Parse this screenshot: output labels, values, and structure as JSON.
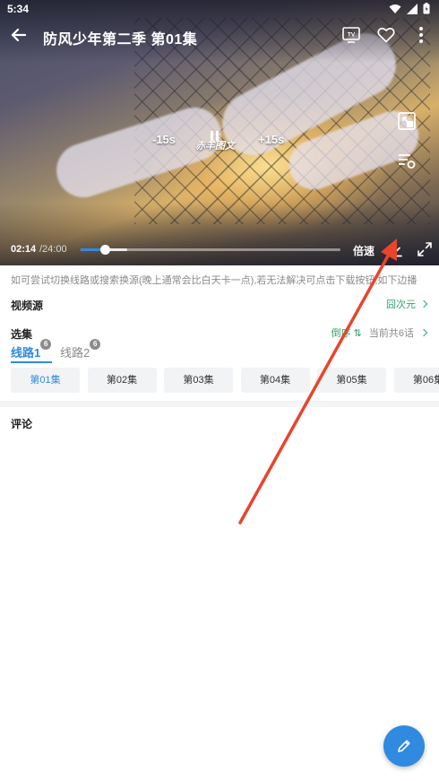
{
  "status_bar": {
    "time": "5:34"
  },
  "header": {
    "title": "防风少年第二季 第01集"
  },
  "player": {
    "seek_back_label": "-15s",
    "seek_forward_label": "+15s",
    "watermark": "赤羊图文",
    "current_time": "02:14",
    "duration": "/24:00",
    "progress": 0.093,
    "buffered": 0.18,
    "speed_label": "倍速"
  },
  "notice_text": "如可尝试切换线路或搜索换源(晚上通常会比白天卡一点),若无法解决可点击下载按钮,如下边播",
  "video_source": {
    "label": "视频源",
    "value": "囧次元"
  },
  "episode_section": {
    "label": "选集",
    "sort_label": "倒序 ⇅",
    "count_label": "当前共6话",
    "lines": [
      {
        "label": "线路1",
        "badge": "6"
      },
      {
        "label": "线路2",
        "badge": "6"
      }
    ],
    "episodes": [
      "第01集",
      "第02集",
      "第03集",
      "第04集",
      "第05集",
      "第06集"
    ]
  },
  "comments": {
    "label": "评论"
  },
  "colors": {
    "accent": "#2f8ae0",
    "green": "#2fa56a",
    "annotation_red": "#e8452c"
  }
}
